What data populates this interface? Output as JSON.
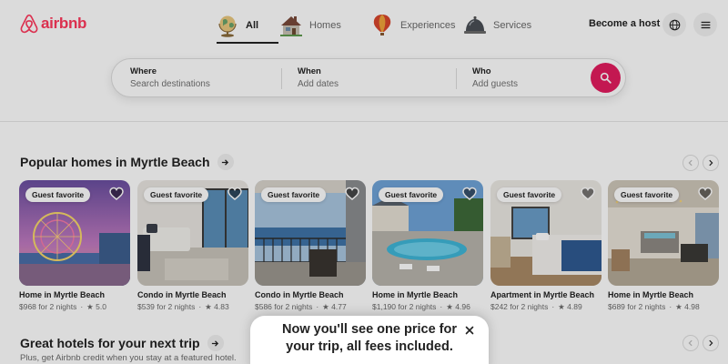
{
  "header": {
    "brand": "airbnb",
    "brand_color": "#ff385c",
    "tabs": [
      {
        "label": "All",
        "icon": "globe-icon",
        "active": true
      },
      {
        "label": "Homes",
        "icon": "house-icon",
        "active": false
      },
      {
        "label": "Experiences",
        "icon": "hot-air-balloon-icon",
        "active": false
      },
      {
        "label": "Services",
        "icon": "service-bell-icon",
        "active": false
      }
    ],
    "host_link": "Become a host",
    "language_icon": "globe-outline-icon",
    "menu_icon": "hamburger-menu-icon"
  },
  "search": {
    "where_label": "Where",
    "where_placeholder": "Search destinations",
    "when_label": "When",
    "when_placeholder": "Add dates",
    "who_label": "Who",
    "who_placeholder": "Add guests",
    "button_color": "#e31c5f",
    "button_icon": "magnifier-icon"
  },
  "popular": {
    "title": "Popular homes in Myrtle Beach",
    "listings": [
      {
        "badge": "Guest favorite",
        "title": "Home in Myrtle Beach",
        "price": "$968 for 2 nights",
        "rating": "★ 5.0"
      },
      {
        "badge": "Guest favorite",
        "title": "Condo in Myrtle Beach",
        "price": "$539 for 2 nights",
        "rating": "★ 4.83"
      },
      {
        "badge": "Guest favorite",
        "title": "Condo in Myrtle Beach",
        "price": "$586 for 2 nights",
        "rating": "★ 4.77"
      },
      {
        "badge": "Guest favorite",
        "title": "Home in Myrtle Beach",
        "price": "$1,190 for 2 nights",
        "rating": "★ 4.96"
      },
      {
        "badge": "Guest favorite",
        "title": "Apartment in Myrtle Beach",
        "price": "$242 for 2 nights",
        "rating": "★ 4.89"
      },
      {
        "badge": "Guest favorite",
        "title": "Home in Myrtle Beach",
        "price": "$689 for 2 nights",
        "rating": "★ 4.98"
      }
    ]
  },
  "hotels": {
    "title": "Great hotels for your next trip",
    "subtitle": "Plus, get Airbnb credit when you stay at a featured hotel."
  },
  "toast": {
    "message": "Now you'll see one price for your trip, all fees included.",
    "close_icon": "close-icon"
  }
}
